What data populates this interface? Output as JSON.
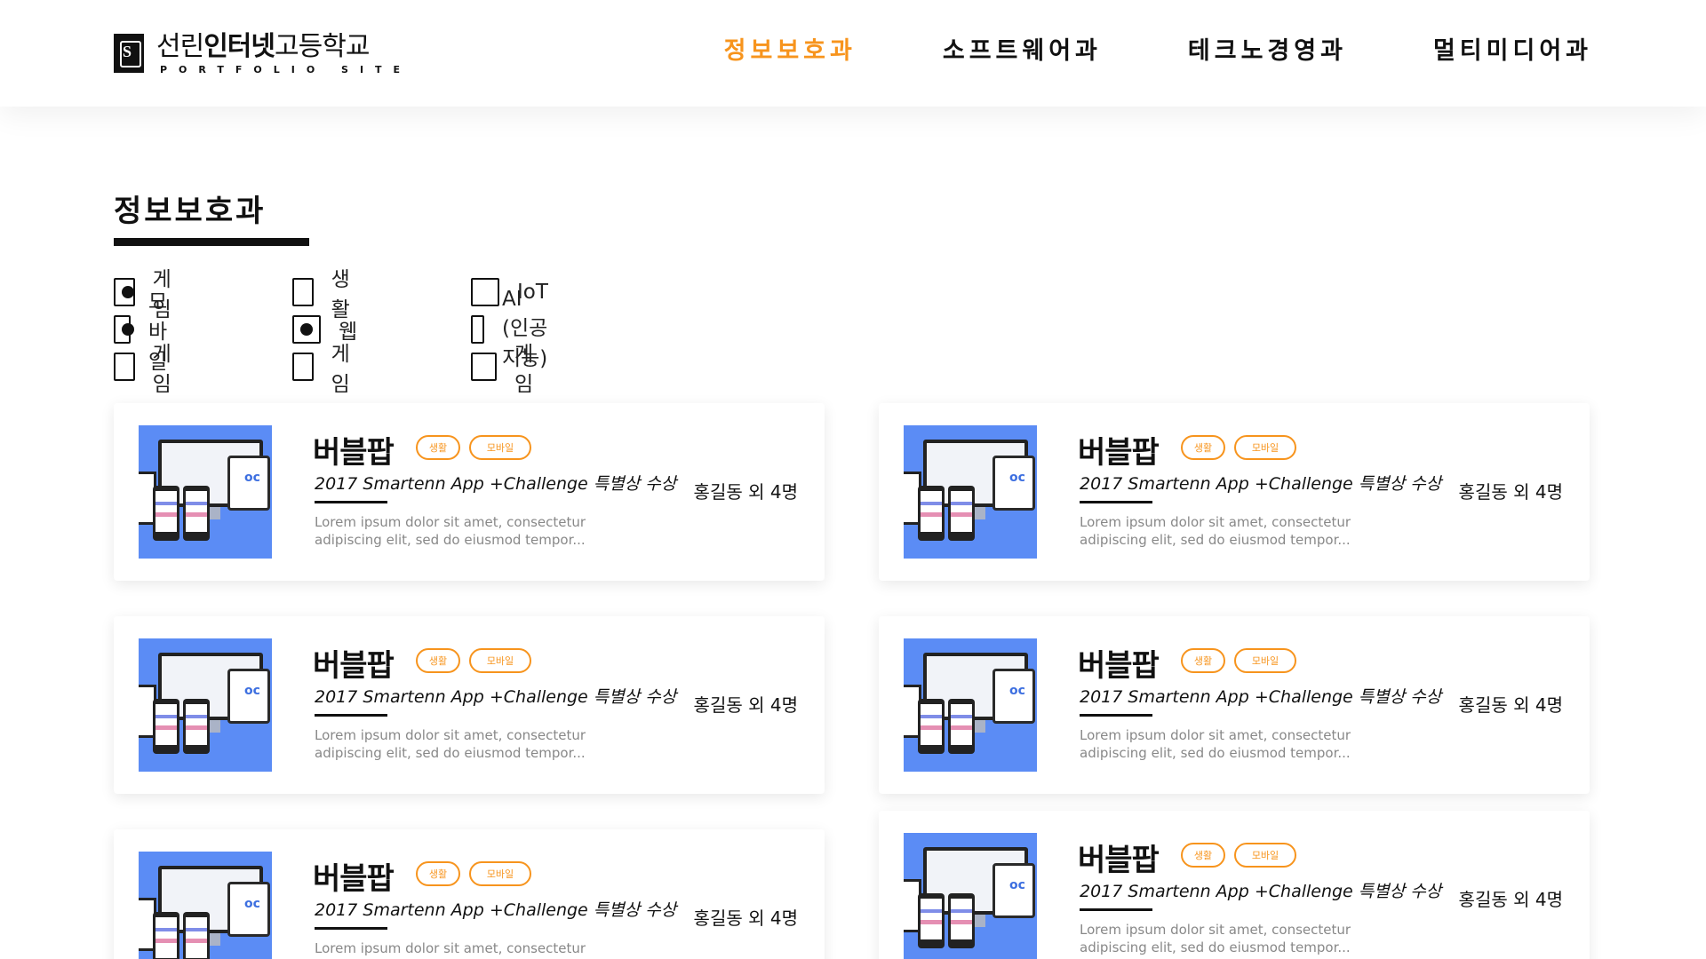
{
  "logo": {
    "title_light_1": "선린",
    "title_bold": "인터넷",
    "title_light_2": "고등학교",
    "subtitle": "PORTFOLIO SITE",
    "mark": "S"
  },
  "nav": {
    "items": [
      {
        "label": "정보보호과",
        "active": true
      },
      {
        "label": "소프트웨어과",
        "active": false
      },
      {
        "label": "테크노경영과",
        "active": false
      },
      {
        "label": "멀티미디어과",
        "active": false
      }
    ]
  },
  "section": {
    "title": "정보보호과"
  },
  "filters": [
    {
      "label": "게임",
      "checked": true
    },
    {
      "label": "모바일",
      "checked": true
    },
    {
      "label": "게임",
      "checked": false
    },
    {
      "label": "생활",
      "checked": false
    },
    {
      "label": "웹",
      "checked": true
    },
    {
      "label": "게임",
      "checked": false
    },
    {
      "label": "IoT",
      "checked": false
    },
    {
      "label": "AI (인공지능)",
      "checked": false
    },
    {
      "label": "게임",
      "checked": false
    }
  ],
  "cards": [
    {
      "title": "버블팝",
      "tags": [
        "생활",
        "모바일"
      ],
      "subtitle": "2017 Smartenn App +Challenge 특별상 수상",
      "description": "Lorem ipsum dolor sit amet, consectetur adipiscing elit, sed do eiusmod tempor...",
      "author": "홍길동 외 4명"
    },
    {
      "title": "버블팝",
      "tags": [
        "생활",
        "모바일"
      ],
      "subtitle": "2017 Smartenn App +Challenge 특별상 수상",
      "description": "Lorem ipsum dolor sit amet, consectetur adipiscing elit, sed do eiusmod tempor...",
      "author": "홍길동 외 4명"
    },
    {
      "title": "버블팝",
      "tags": [
        "생활",
        "모바일"
      ],
      "subtitle": "2017 Smartenn App +Challenge 특별상 수상",
      "description": "Lorem ipsum dolor sit amet, consectetur adipiscing elit, sed do eiusmod tempor...",
      "author": "홍길동 외 4명"
    },
    {
      "title": "버블팝",
      "tags": [
        "생활",
        "모바일"
      ],
      "subtitle": "2017 Smartenn App +Challenge 특별상 수상",
      "description": "Lorem ipsum dolor sit amet, consectetur adipiscing elit, sed do eiusmod tempor...",
      "author": "홍길동 외 4명"
    },
    {
      "title": "버블팝",
      "tags": [
        "생활",
        "모바일"
      ],
      "subtitle": "2017 Smartenn App +Challenge 특별상 수상",
      "description": "Lorem ipsum dolor sit amet, consectetur adipiscing",
      "author": "홍길동 외 4명"
    },
    {
      "title": "버블팝",
      "tags": [
        "생활",
        "모바일"
      ],
      "subtitle": "2017 Smartenn App +Challenge 특별상 수상",
      "description": "Lorem ipsum dolor sit amet, consectetur adipiscing elit, sed do eiusmod tempor...",
      "author": "홍길동 외 4명"
    }
  ],
  "colors": {
    "accent": "#f7941d",
    "thumb_bg": "#5b8cf5"
  }
}
